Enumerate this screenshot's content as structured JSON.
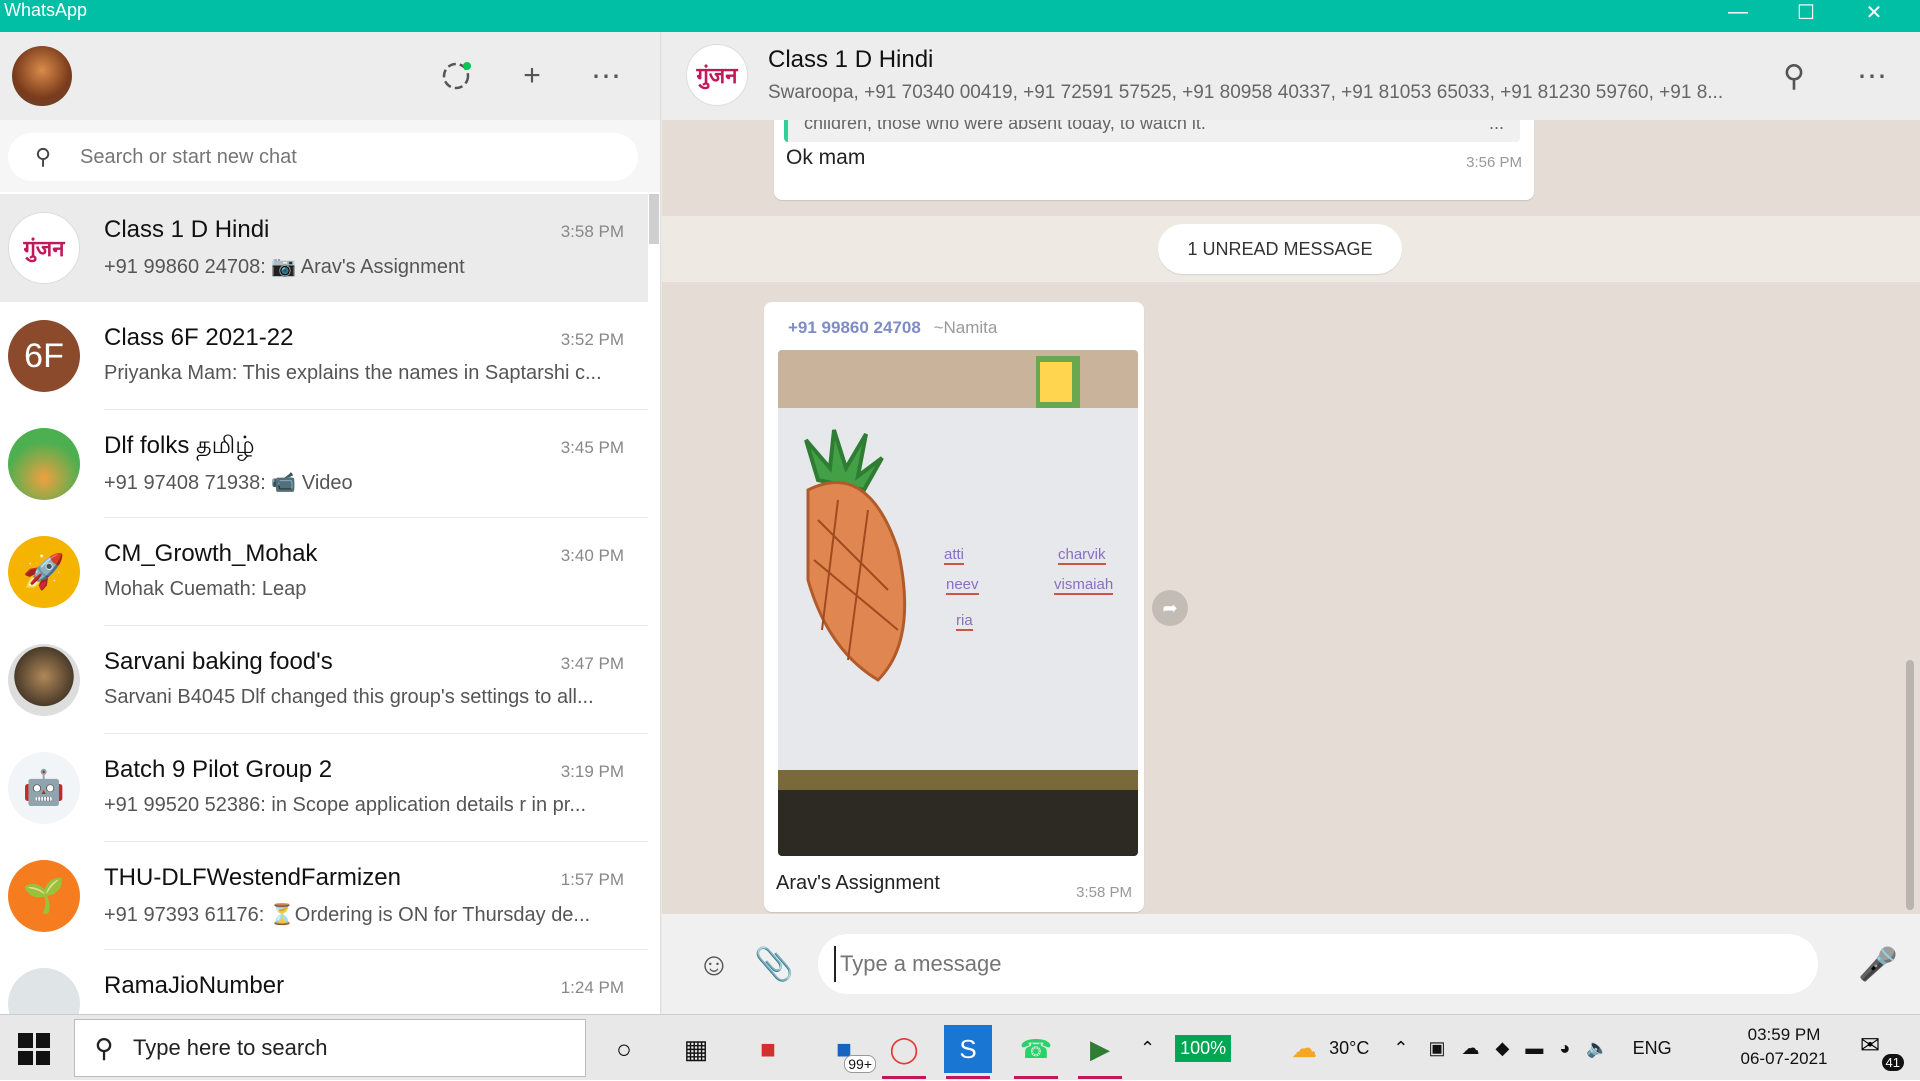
{
  "window": {
    "title": "WhatsApp"
  },
  "sidebar": {
    "search_placeholder": "Search or start new chat",
    "chats": [
      {
        "name": "Class 1 D Hindi",
        "time": "3:58 PM",
        "preview": "+91 99860 24708: 📷 Arav's Assignment",
        "avatar_text": "गुंजन",
        "avatar_color": "#ffffff",
        "active": true
      },
      {
        "name": "Class 6F 2021-22",
        "time": "3:52 PM",
        "preview": "Priyanka Mam: This explains the names in  Saptarshi c...",
        "avatar_text": "6F",
        "avatar_color": "#8b4a2b"
      },
      {
        "name": "Dlf folks தமிழ்",
        "time": "3:45 PM",
        "preview": "+91 97408 71938: 📹 Video",
        "avatar_text": "",
        "avatar_color": "#4caf50"
      },
      {
        "name": "CM_Growth_Mohak",
        "time": "3:40 PM",
        "preview": "Mohak Cuemath: Leap",
        "avatar_text": "🚀",
        "avatar_color": "#f5b400"
      },
      {
        "name": "Sarvani baking food's",
        "time": "3:47 PM",
        "preview": "Sarvani B4045 Dlf changed this group's settings to all...",
        "avatar_text": "",
        "avatar_color": "#4a3b2a"
      },
      {
        "name": "Batch 9 Pilot Group 2",
        "time": "3:19 PM",
        "preview": "+91 99520 52386: in Scope application details r in pr...",
        "avatar_text": "🤖",
        "avatar_color": "#e8eef4"
      },
      {
        "name": "THU-DLFWestendFarmizen",
        "time": "1:57 PM",
        "preview": "+91 97393 61176: ⏳Ordering is ON for Thursday de...",
        "avatar_text": "🌱",
        "avatar_color": "#f57c1f"
      },
      {
        "name": "RamaJioNumber",
        "time": "1:24 PM",
        "preview": "",
        "avatar_text": "",
        "avatar_color": "#dfe5e7"
      }
    ]
  },
  "conversation": {
    "group_name": "Class 1 D Hindi",
    "group_avatar_text": "गुंजन",
    "participants": "Swaroopa, +91 70340 00419, +91 72591 57525, +91 80958 40337, +91 81053 65033, +91 81230 59760, +91 8...",
    "prev_quote": "children, those who were absent today, to watch it.",
    "prev_quote_more": "...",
    "prev_text": "Ok mam",
    "prev_time": "3:56 PM",
    "unread_label": "1 UNREAD MESSAGE",
    "image_message": {
      "sender_number": "+91 99860 24708",
      "sender_nick": "~Namita",
      "photo_labels": [
        "atti",
        "charvik",
        "neev",
        "vismaiah",
        "ria"
      ],
      "caption": "Arav's Assignment",
      "time": "3:58 PM"
    },
    "composer_placeholder": "Type a message"
  },
  "taskbar": {
    "search_text": "Type here to search",
    "badge_count": "99+",
    "battery": "100%",
    "temperature": "30°C",
    "language": "ENG",
    "time": "03:59 PM",
    "date": "06-07-2021",
    "notifications": "41"
  },
  "colors": {
    "accent": "#00bfa5",
    "sender": "#7d8cc6"
  }
}
